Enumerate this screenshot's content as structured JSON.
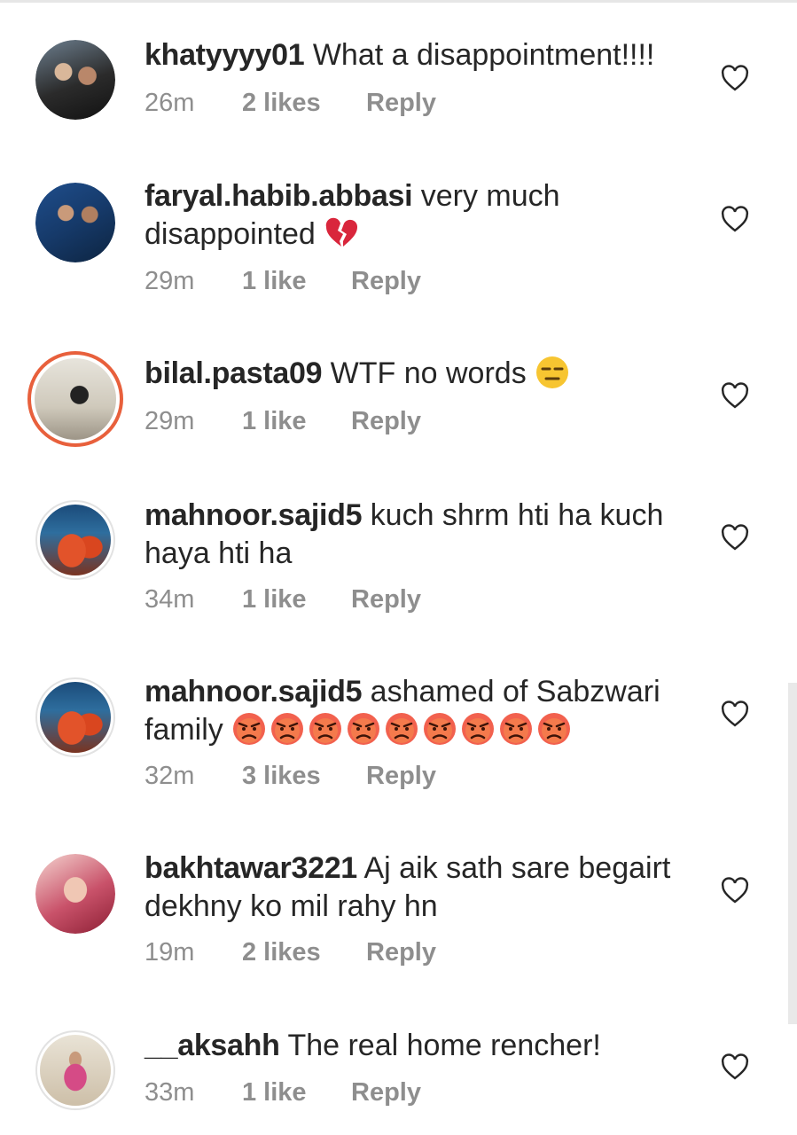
{
  "comments": [
    {
      "user": "khatyyyy01",
      "text": "What a disappointment!!!!",
      "time": "26m",
      "likes": "2 likes",
      "reply": "Reply"
    },
    {
      "user": "faryal.habib.abbasi",
      "text": "very much disappointed",
      "time": "29m",
      "likes": "1 like",
      "reply": "Reply",
      "emoji": "broken-heart"
    },
    {
      "user": "bilal.pasta09",
      "text": "WTF no words",
      "time": "29m",
      "likes": "1 like",
      "reply": "Reply",
      "emoji": "expressionless-face"
    },
    {
      "user": "mahnoor.sajid5",
      "text": "kuch shrm hti ha kuch haya hti ha",
      "time": "34m",
      "likes": "1 like",
      "reply": "Reply"
    },
    {
      "user": "mahnoor.sajid5",
      "text": "ashamed of Sabzwari family",
      "time": "32m",
      "likes": "3 likes",
      "reply": "Reply",
      "emoji": "angry-face",
      "emoji_count": 9
    },
    {
      "user": "bakhtawar3221",
      "text": "Aj aik sath sare begairt dekhny ko mil rahy hn",
      "time": "19m",
      "likes": "2 likes",
      "reply": "Reply"
    },
    {
      "user": "__aksahh",
      "text": "The real home rencher!",
      "time": "33m",
      "likes": "1 like",
      "reply": "Reply"
    }
  ],
  "icons": {
    "like": "heart-outline-icon"
  },
  "colors": {
    "text": "#262626",
    "meta": "#8e8e8e",
    "story_ring": "#e8603c"
  }
}
